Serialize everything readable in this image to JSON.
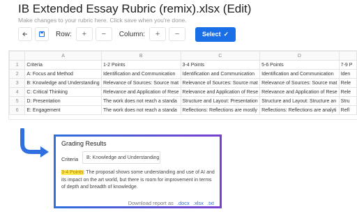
{
  "header": {
    "title": "IB Extended Essay Rubric (remix).xlsx (Edit)",
    "subtitle": "Make changes to your rubric here. Click save when you're done."
  },
  "toolbar": {
    "row_label": "Row:",
    "column_label": "Column:",
    "plus": "+",
    "minus": "−",
    "select_label": "Select",
    "select_check": "✓"
  },
  "sheet": {
    "col_headers": [
      "",
      "A",
      "B",
      "C",
      "D",
      ""
    ],
    "rows": [
      [
        "1",
        "Criteria",
        "1-2 Points",
        "3-4 Points",
        "5-6 Points",
        "7-9 P"
      ],
      [
        "2",
        "A: Focus and Method",
        "Identification and Communication",
        "Identification and Communication",
        "Identification and Communication",
        "Iden"
      ],
      [
        "3",
        "B: Knowledge and Understanding",
        "Relevance of Sources: Source mat",
        "Relevance of Sources: Source mat",
        "Relevance of Sources: Source mat",
        "Rele"
      ],
      [
        "4",
        "C: Critical Thinking",
        "Relevance and Application of Rese",
        "Relevance and Application of Rese",
        "Relevance and Application of Rese",
        "Rele"
      ],
      [
        "5",
        "D: Presentation",
        "The work does not reach a standa",
        "Structure and Layout: Presentation",
        "Structure and Layout: Structure an",
        "Stru"
      ],
      [
        "6",
        "E: Engagement",
        "The work does not reach a standa",
        "Reflections: Reflections are mostly",
        "Reflections: Reflections are analyti",
        "Refl"
      ]
    ]
  },
  "panel": {
    "title": "Grading Results",
    "criteria_label": "Criteria",
    "criteria_value": "B: Knowledge and Understanding",
    "criteria_chevron": "⌄",
    "result_highlight": "3-4 Points",
    "result_text": ": The proposal shows some understanding and use of AI and its impact on the art world, but there is room for improvement in terms of depth and breadth of knowledge.",
    "download_label": "Download report as",
    "formats": [
      ".docx",
      ".xlsx",
      ".txt"
    ]
  },
  "colors": {
    "accent": "#1a6ee6",
    "arrow": "#2f6fe0",
    "panel_border_start": "#2f6fe0",
    "panel_border_end": "#7a3fd0",
    "highlight": "#fde84a"
  },
  "icons": {
    "back": "arrow-left-icon",
    "save": "floppy-disk-icon",
    "check": "check-icon",
    "curved_arrow": "curved-arrow-icon"
  }
}
